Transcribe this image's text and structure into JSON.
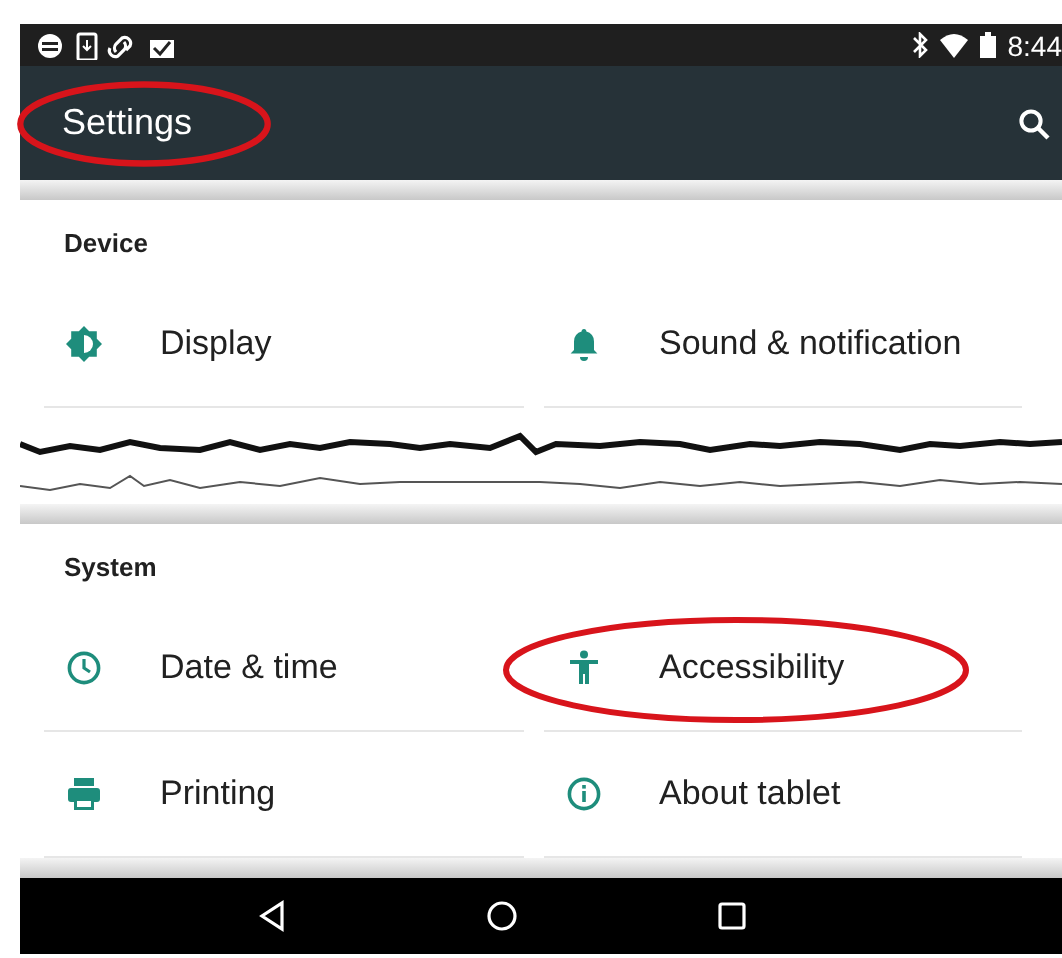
{
  "status_bar": {
    "time": "8:44"
  },
  "toolbar": {
    "title": "Settings",
    "annotated": true
  },
  "sections": [
    {
      "header": "Device",
      "items": [
        {
          "label": "Display",
          "kind": "brightness",
          "annotated": false
        },
        {
          "label": "Sound & notification",
          "kind": "bell",
          "annotated": false
        }
      ]
    },
    {
      "header": "System",
      "items": [
        {
          "label": "Date & time",
          "kind": "clock",
          "annotated": false
        },
        {
          "label": "Accessibility",
          "kind": "accessibility",
          "annotated": true
        },
        {
          "label": "Printing",
          "kind": "printer",
          "annotated": false
        },
        {
          "label": "About tablet",
          "kind": "info",
          "annotated": false
        }
      ]
    }
  ]
}
